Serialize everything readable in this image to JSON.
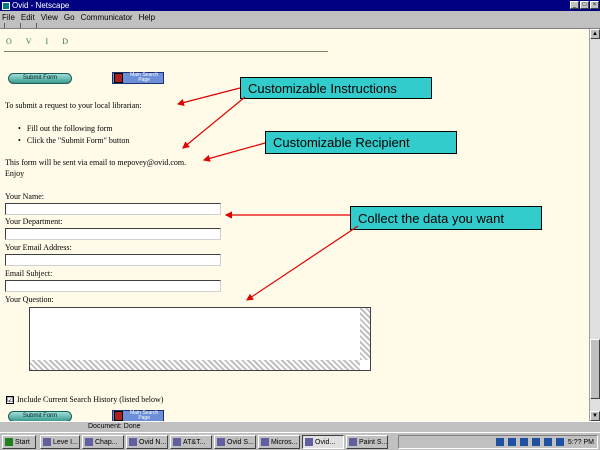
{
  "window": {
    "title": "Ovid - Netscape",
    "controls": [
      "_",
      "□",
      "×"
    ]
  },
  "menu": [
    "File",
    "Edit",
    "View",
    "Go",
    "Communicator",
    "Help"
  ],
  "page": {
    "logo": "OVID",
    "submit_label": "Submit Form",
    "search_page_label": "Main Search Page",
    "intro": "To submit a request to your local librarian:",
    "bullets": [
      "Fill out the following form",
      "Click the \"Submit Form\" button"
    ],
    "recipient_line": "This form will be sent via email to mepovey@ovid.com.",
    "enjoy": "Enjoy",
    "fields": [
      {
        "label": "Your Name:",
        "value": ""
      },
      {
        "label": "Your Department:",
        "value": ""
      },
      {
        "label": "Your Email Address:",
        "value": ""
      },
      {
        "label": "Email Subject:",
        "value": ""
      }
    ],
    "question_label": "Your Question:",
    "question_value": "",
    "include_history_label": "Include Current Search History (listed below)",
    "include_history_checked": "☑"
  },
  "callouts": {
    "instructions": "Customizable Instructions",
    "recipient": "Customizable Recipient",
    "collect": "Collect the data you want"
  },
  "colors": {
    "callout_bg": "#33cccc",
    "arrow": "#e00000",
    "page_bg": "#fffbe8"
  },
  "status": "Document: Done",
  "taskbar": {
    "start": "Start",
    "tasks": [
      "Leve I...",
      "Chap...",
      "Ovid N...",
      "AT&T...",
      "Ovid S...",
      "Micros...",
      "Ovid...",
      "Paint S..."
    ],
    "clock": "5:?? PM"
  }
}
